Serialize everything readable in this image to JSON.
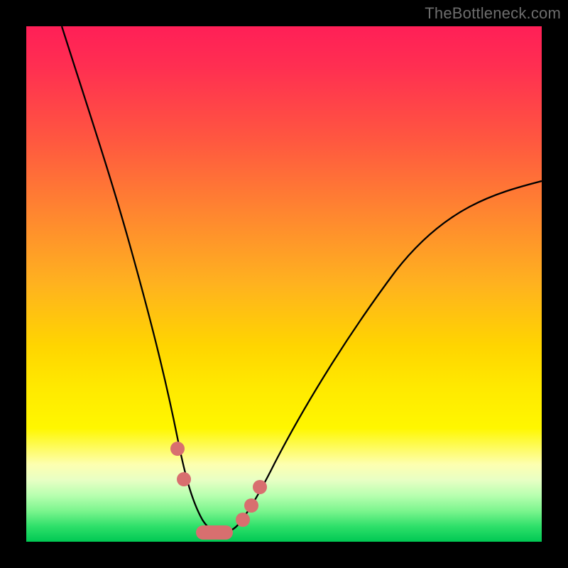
{
  "watermark": "TheBottleneck.com",
  "colors": {
    "frame_background": "#000000",
    "watermark_text": "#6d6d6d",
    "curve_stroke": "#000000",
    "marker_fill": "#d86f6f",
    "gradient_stops": [
      "#ff1f57",
      "#ff2f51",
      "#ff5740",
      "#ff8530",
      "#ffb21f",
      "#ffd500",
      "#ffe900",
      "#fff700",
      "#fdffb0",
      "#e8ffc4",
      "#b8ffb0",
      "#7cf58e",
      "#2fe06a",
      "#00c853"
    ]
  },
  "chart_data": {
    "type": "line",
    "title": "",
    "xlabel": "",
    "ylabel": "",
    "xlim": [
      0,
      100
    ],
    "ylim": [
      0,
      100
    ],
    "note": "Color gradient encodes y-value: ~100→red, ~0→green. Axes are unlabeled in the source image; values below are proportional readings off the 726×726 plotting area.",
    "series": [
      {
        "name": "bottleneck-curve",
        "x": [
          7,
          12,
          16,
          20,
          24,
          27,
          29,
          31,
          33,
          35,
          36.5,
          38,
          40,
          43,
          48,
          55,
          63,
          72,
          82,
          92,
          100
        ],
        "y": [
          100,
          85,
          72,
          58,
          43,
          30,
          20,
          12,
          7,
          3.5,
          2,
          2,
          2.5,
          5.5,
          12,
          22,
          34,
          46,
          56,
          64,
          70
        ]
      }
    ],
    "markers": [
      {
        "name": "left-upper",
        "x": 29.3,
        "y": 18.0
      },
      {
        "name": "left-lower",
        "x": 30.6,
        "y": 12.0
      },
      {
        "name": "right-lower",
        "x": 42.0,
        "y": 4.3
      },
      {
        "name": "right-mid",
        "x": 43.7,
        "y": 7.0
      },
      {
        "name": "right-upper",
        "x": 45.3,
        "y": 10.6
      }
    ],
    "trough_segment": {
      "name": "valley-blob",
      "x_start": 33.0,
      "x_end": 40.0,
      "y": 2.0
    }
  }
}
